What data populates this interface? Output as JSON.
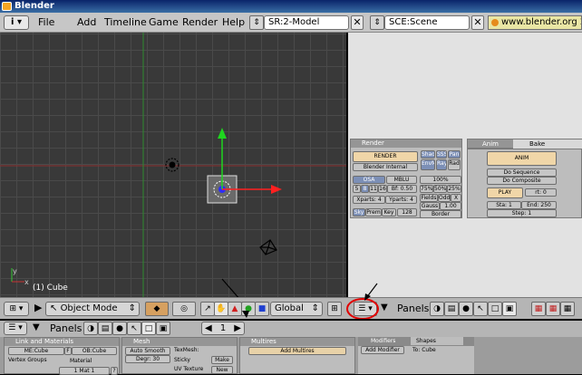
{
  "window": {
    "title": "Blender"
  },
  "menubar": {
    "items": [
      "File",
      "Add",
      "Timeline",
      "Game",
      "Render",
      "Help"
    ],
    "screen": "SR:2-Model",
    "scene": "SCE:Scene",
    "url": "www.blender.org 2"
  },
  "viewport": {
    "object_label": "(1) Cube"
  },
  "header3d": {
    "mode": "Object Mode",
    "orientation": "Global",
    "panels_label": "Panels"
  },
  "render_panel": {
    "tab_render": "Render",
    "tab_anim": "Anim",
    "tab_bake": "Bake",
    "render_btn": "RENDER",
    "renderer": "Blender Internal",
    "osa": "OSA",
    "mblur": "MBLU",
    "pct100": "100%",
    "osa_vals": [
      "5",
      "8",
      "11",
      "16"
    ],
    "bf": "Bf: 0.50",
    "pcts": [
      "75%",
      "50%",
      "25%"
    ],
    "shad": "Shad",
    "ss": "SSS",
    "pano": "Pan",
    "envmap": "EnvMap",
    "ray": "Ray",
    "radio": "Rad",
    "xparts": "Xparts: 4",
    "yparts": "Yparts: 4",
    "fields": "Fields",
    "odd": "Odd",
    "x": "X",
    "gauss": "Gauss",
    "gauss_val": "1.00",
    "sky": "Sky",
    "premul": "Prem",
    "key": "Key",
    "depth": "128",
    "border": "Border"
  },
  "anim_panel": {
    "anim_btn": "ANIM",
    "do_sequence": "Do Sequence",
    "do_composite": "Do Composite",
    "play": "PLAY",
    "rt": "rt: 0",
    "sta": "Sta: 1",
    "end": "End: 250",
    "step": "Step: 1"
  },
  "header2": {
    "panels_label": "Panels",
    "frame": "1"
  },
  "lower": {
    "link_materials": "Link and Materials",
    "me": "ME:Cube",
    "ob": "OB:Cube",
    "f": "F",
    "vertex_groups": "Vertex Groups",
    "material": "Material",
    "mat_num": "1 Mat 1",
    "q": "?",
    "mesh": "Mesh",
    "auto_smooth": "Auto Smooth",
    "degr": "Degr: 30",
    "texmesh": "TexMesh:",
    "sticky": "Sticky",
    "make": "Make",
    "uv_texture": "UV Texture",
    "new": "New",
    "multires": "Multires",
    "add_multires": "Add Multires",
    "modifiers": "Modifiers",
    "shapes": "Shapes",
    "add_modifier": "Add Modifier",
    "to_cube": "To: Cube"
  },
  "colors": {
    "title": "#0a246a",
    "grid": "#393939",
    "x_axis": "#a83232",
    "y_axis": "#34a834",
    "highlight": "#e10000"
  }
}
